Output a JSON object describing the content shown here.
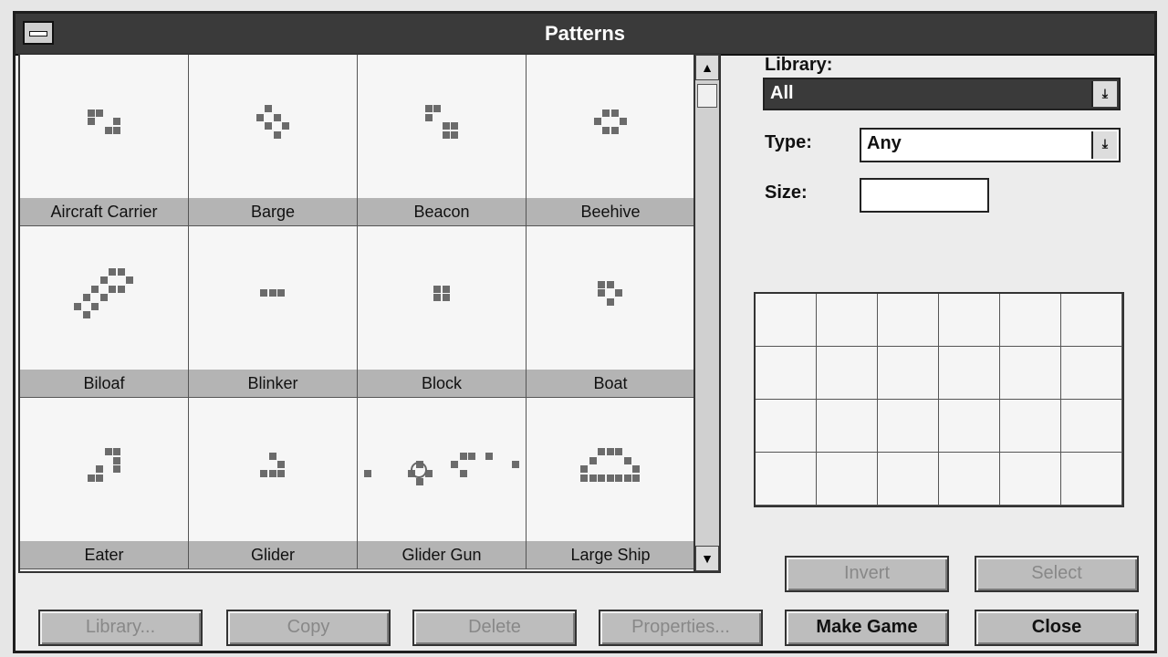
{
  "window": {
    "title": "Patterns"
  },
  "patterns": [
    {
      "name": "Aircraft Carrier",
      "icon": "aircraft-carrier-pattern"
    },
    {
      "name": "Barge",
      "icon": "barge-pattern"
    },
    {
      "name": "Beacon",
      "icon": "beacon-pattern"
    },
    {
      "name": "Beehive",
      "icon": "beehive-pattern"
    },
    {
      "name": "Biloaf",
      "icon": "biloaf-pattern"
    },
    {
      "name": "Blinker",
      "icon": "blinker-pattern"
    },
    {
      "name": "Block",
      "icon": "block-pattern"
    },
    {
      "name": "Boat",
      "icon": "boat-pattern"
    },
    {
      "name": "Eater",
      "icon": "eater-pattern"
    },
    {
      "name": "Glider",
      "icon": "glider-pattern"
    },
    {
      "name": "Glider Gun",
      "icon": "glider-gun-pattern"
    },
    {
      "name": "Large Ship",
      "icon": "large-ship-pattern"
    }
  ],
  "filters": {
    "library_label": "Library:",
    "library_value": "All",
    "type_label": "Type:",
    "type_value": "Any",
    "size_label": "Size:",
    "size_value": ""
  },
  "buttons": {
    "invert": "Invert",
    "select": "Select",
    "library": "Library...",
    "copy": "Copy",
    "delete": "Delete",
    "properties": "Properties...",
    "make_game": "Make Game",
    "close": "Close"
  },
  "scroll": {
    "up_icon": "scroll-up-arrow-icon",
    "down_icon": "scroll-down-arrow-icon"
  }
}
